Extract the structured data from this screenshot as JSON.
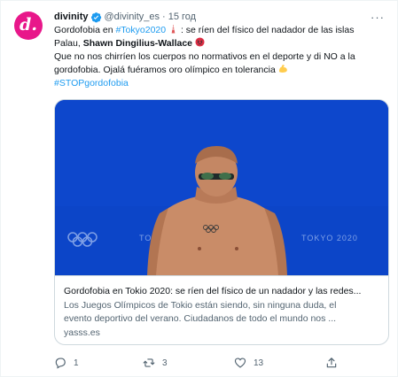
{
  "tweet": {
    "author_name": "divinity",
    "author_handle": "@divinity_es",
    "separator": "·",
    "time": "15 год",
    "avatar_letter": "d.",
    "more": "···",
    "text": {
      "l1_a": "Gordofobia en ",
      "l1_hashtag": "#Tokyo2020",
      "l1_b": " : se ríen del físico del nadador de las islas",
      "l2_a": "Palau, ",
      "l2_bold": "Shawn Dingilius-Wallace",
      "l3": "Que no nos chirríen los cuerpos no normativos en el deporte y di NO a la",
      "l4": "gordofobia. Ojalá fuéramos oro olímpico en tolerancia",
      "l5_hashtag": "#STOPgordofobia"
    },
    "emoji": {
      "tower": "tokyo-tower-emoji",
      "angry": "angry-face-emoji",
      "muscle": "flexed-biceps-emoji"
    }
  },
  "card": {
    "title": "Gordofobia en Tokio 2020: se ríen del físico de un nadador y las redes...",
    "description_lines": [
      "Los Juegos Olímpicos de Tokio están siendo, sin ninguna duda, el",
      "evento deportivo del verano. Ciudadanos de todo el mundo nos ..."
    ],
    "domain": "yasss.es",
    "image_text_left": "TOKYO 2020",
    "image_text_right": "TOKYO 2020"
  },
  "actions": {
    "reply_count": "1",
    "retweet_count": "3",
    "like_count": "13"
  },
  "colors": {
    "accent": "#1d9bf0",
    "avatar": "#e8178a",
    "image_blue": "#0d4ad0"
  }
}
